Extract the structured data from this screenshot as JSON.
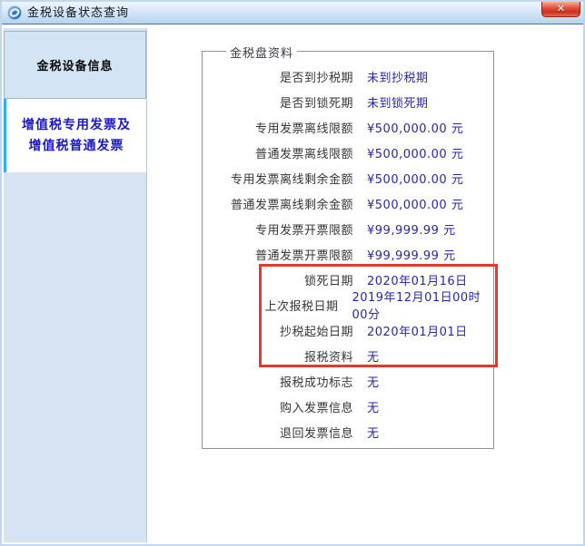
{
  "window": {
    "title": "金税设备状态查询",
    "close_glyph": "✕"
  },
  "icons": {
    "app_icon": "blue-swirl-disc",
    "close_icon": "close-x"
  },
  "sidebar": {
    "items": [
      {
        "label": "金税设备信息",
        "selected": false
      },
      {
        "label": "增值税专用发票及增值税普通发票",
        "selected": true
      }
    ]
  },
  "main": {
    "groupbox_title": "金税盘资料",
    "rows": [
      {
        "label": "是否到抄税期",
        "value": "未到抄税期"
      },
      {
        "label": "是否到锁死期",
        "value": "未到锁死期"
      },
      {
        "label": "专用发票离线限额",
        "value": "¥500,000.00 元"
      },
      {
        "label": "普通发票离线限额",
        "value": "¥500,000.00 元"
      },
      {
        "label": "专用发票离线剩余金额",
        "value": "¥500,000.00 元"
      },
      {
        "label": "普通发票离线剩余金额",
        "value": "¥500,000.00 元"
      },
      {
        "label": "专用发票开票限额",
        "value": "¥99,999.99 元"
      },
      {
        "label": "普通发票开票限额",
        "value": "¥99,999.99 元"
      },
      {
        "label": "锁死日期",
        "value": "2020年01月16日"
      },
      {
        "label": "上次报税日期",
        "value": "2019年12月01日00时00分"
      },
      {
        "label": "抄税起始日期",
        "value": "2020年01月01日"
      },
      {
        "label": "报税资料",
        "value": "无"
      },
      {
        "label": "报税成功标志",
        "value": "无"
      },
      {
        "label": "购入发票信息",
        "value": "无"
      },
      {
        "label": "退回发票信息",
        "value": "无"
      }
    ],
    "highlight": {
      "first_row_label": "锁死日期",
      "last_row_label": "报税资料",
      "border_color": "#e23b2e"
    }
  },
  "colors": {
    "sidebar_bg": "#d5e3f3",
    "selected_tab_text": "#1b19c6",
    "selected_tab_strip": "#2db3e8",
    "label_text": "#35353b",
    "value_text": "#2828a5",
    "highlight_border": "#e23b2e",
    "close_button": "#d9412f",
    "titlebar_gradient_bottom": "#b5d3ef"
  }
}
